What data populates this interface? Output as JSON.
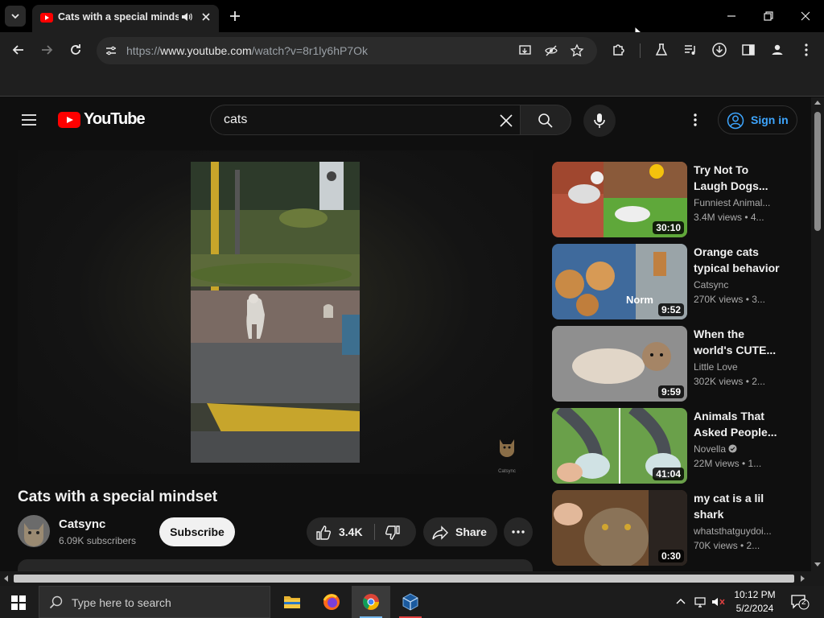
{
  "browser": {
    "tab_title": "Cats with a special mindset",
    "url_prefix": "https://",
    "url_host": "www.youtube.com",
    "url_path": "/watch?v=8r1ly6hP7Ok"
  },
  "masthead": {
    "logo_text": "YouTube",
    "search_query": "cats",
    "sign_in": "Sign in"
  },
  "video": {
    "title": "Cats with a special mindset",
    "channel": "Catsync",
    "subscribers": "6.09K subscribers",
    "subscribe_label": "Subscribe",
    "likes": "3.4K",
    "share_label": "Share",
    "watermark_text": "Catsync"
  },
  "recommendations": [
    {
      "title": "Try Not To Laugh Dogs...",
      "channel": "Funniest Animal...",
      "meta": "3.4M views  • 4...",
      "duration": "30:10",
      "verified": false
    },
    {
      "title": "Orange cats typical behavior",
      "channel": "Catsync",
      "meta": "270K views  • 3...",
      "duration": "9:52",
      "overlay_text": "Norm",
      "verified": false
    },
    {
      "title": "When the world's CUTE...",
      "channel": "Little Love",
      "meta": "302K views  • 2...",
      "duration": "9:59",
      "verified": false
    },
    {
      "title": "Animals That Asked People...",
      "channel": "Novella",
      "meta": "22M views  • 1...",
      "duration": "41:04",
      "verified": true
    },
    {
      "title": "my cat is a lil shark",
      "channel": "whatsthatguydoi...",
      "meta": "70K views  • 2...",
      "duration": "0:30",
      "verified": false
    }
  ],
  "taskbar": {
    "search_placeholder": "Type here to search",
    "time": "10:12 PM",
    "date": "5/2/2024",
    "notification_count": "2"
  }
}
